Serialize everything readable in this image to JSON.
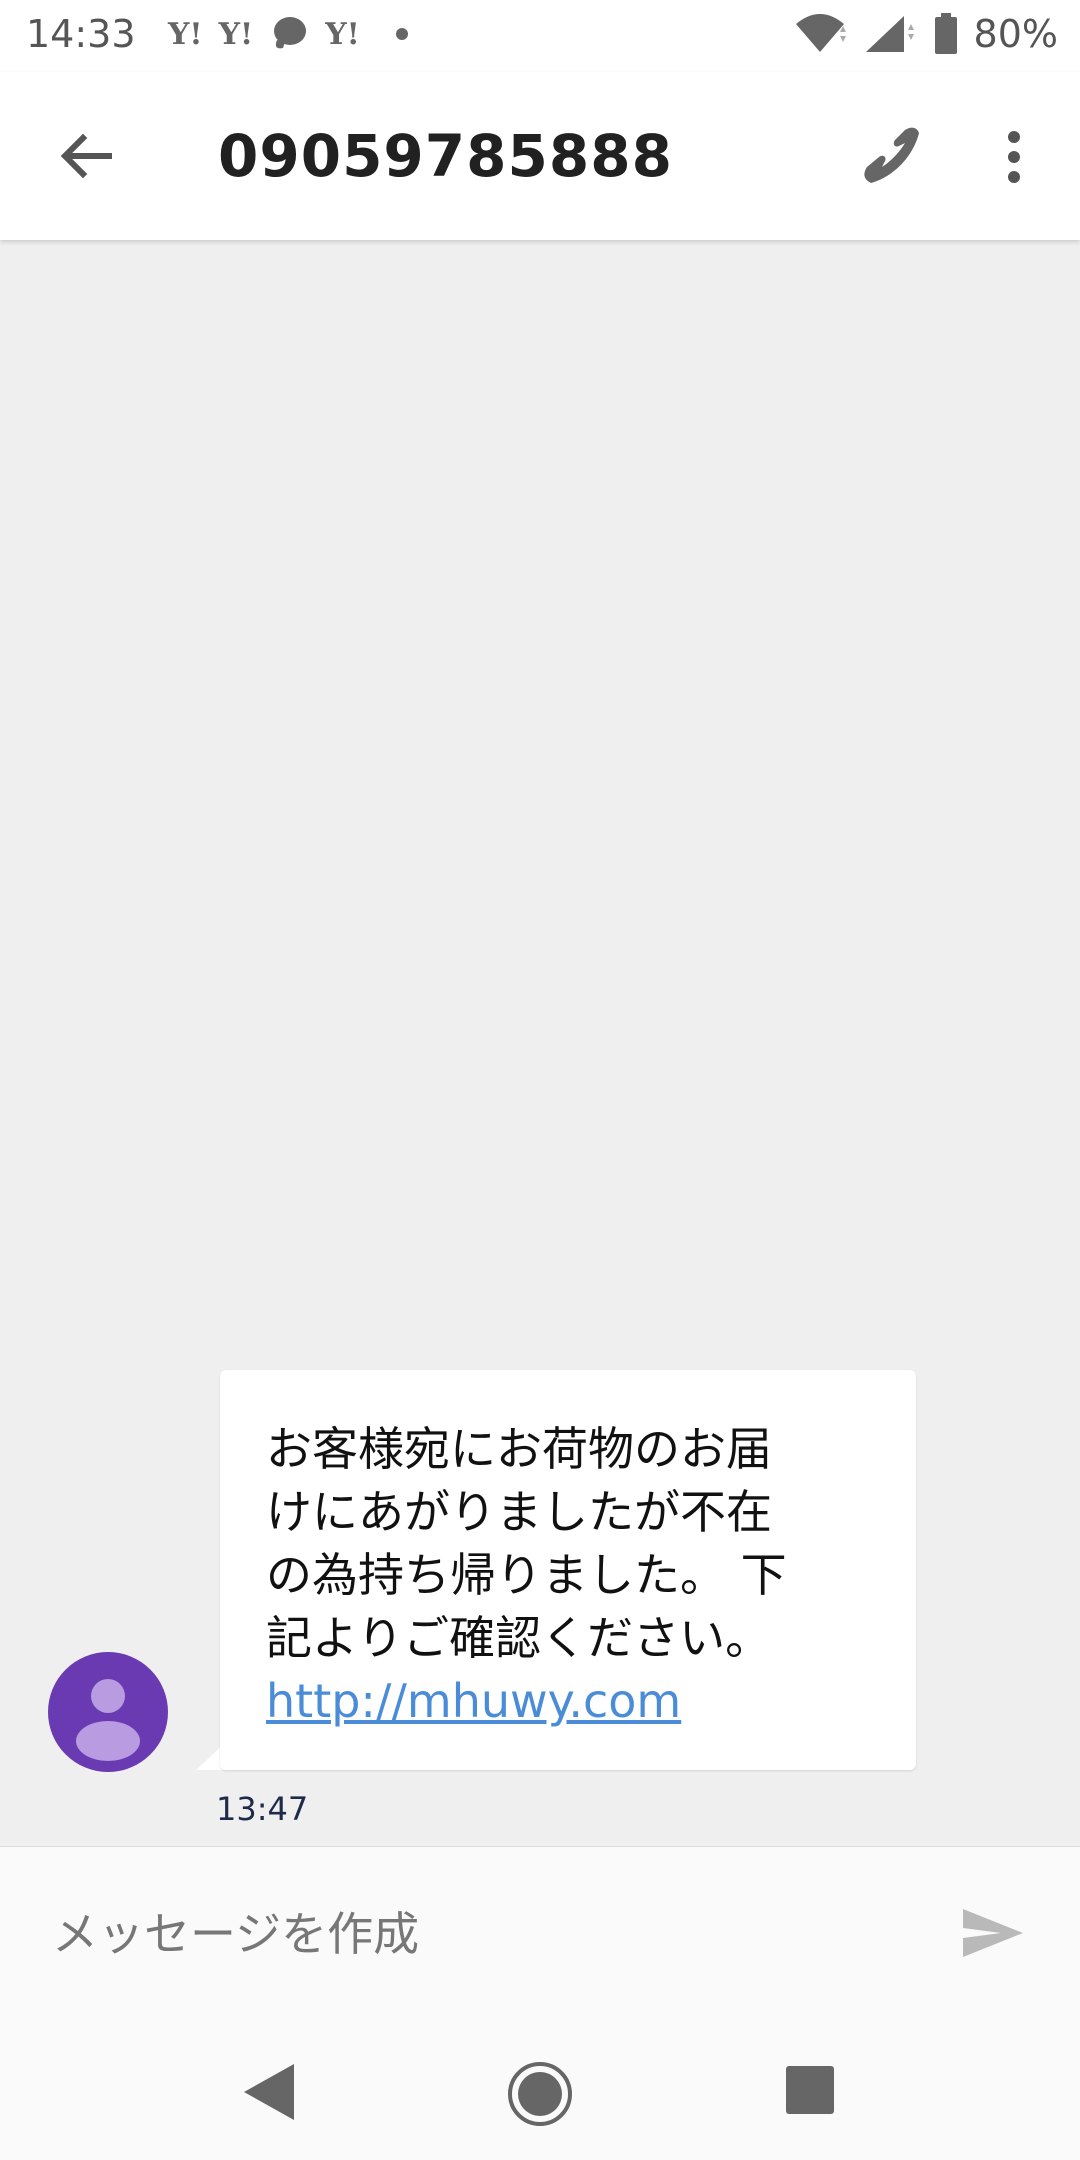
{
  "status_bar": {
    "time": "14:33",
    "notifications": [
      {
        "icon": "yahoo-icon",
        "text": "Y!"
      },
      {
        "icon": "yahoo-icon",
        "text": "Y!"
      },
      {
        "icon": "chat-bubble-icon"
      },
      {
        "icon": "yahoo-icon",
        "text": "Y!"
      },
      {
        "icon": "more-notifications-dot-icon"
      }
    ],
    "battery": "80%",
    "battery_level": 0.8,
    "icons": [
      "wifi-icon",
      "signal-icon",
      "battery-icon"
    ]
  },
  "app_bar": {
    "title": "09059785888",
    "icons": [
      "back-arrow-icon",
      "phone-icon",
      "more-vert-icon"
    ]
  },
  "conversation": {
    "messages": [
      {
        "sender_avatar_icon": "person-icon",
        "text": "お客様宛にお荷物のお届\nけにあがりましたが不在\nの為持ち帰りました。 下\n記よりご確認ください。",
        "link": "http://mhuwy.com",
        "time": "13:47"
      }
    ]
  },
  "composer": {
    "placeholder": "メッセージを作成",
    "value": "",
    "send_icon": "send-icon"
  },
  "nav_bar": {
    "icons": [
      "nav-back-icon",
      "nav-home-icon",
      "nav-recents-icon"
    ]
  },
  "colors": {
    "avatar": "#6a3ab2",
    "link": "#4a8cd8",
    "background": "#efeff0"
  }
}
